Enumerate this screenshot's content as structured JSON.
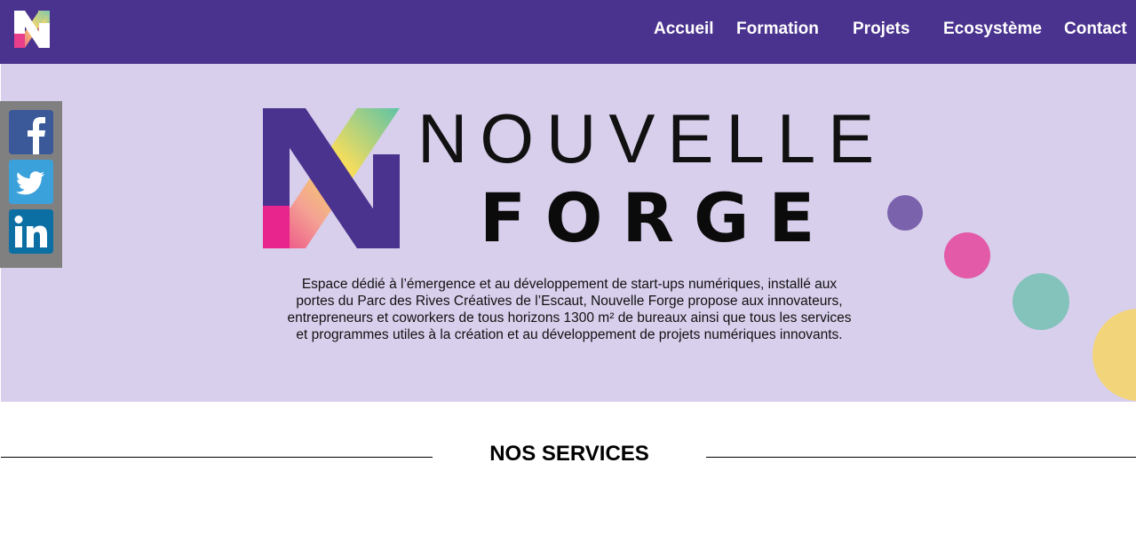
{
  "nav": {
    "items": [
      {
        "label": "Accueil"
      },
      {
        "label": "Formation"
      },
      {
        "label": "Projets"
      },
      {
        "label": "Ecosystème"
      },
      {
        "label": "Contact"
      }
    ]
  },
  "hero": {
    "brand_line1": "NOUVELLE",
    "brand_line2": "FORGE",
    "description": "Espace dédié à l’émergence et au développement de start-ups numériques, installé aux portes du Parc des Rives Créatives de l’Escaut, Nouvelle Forge propose aux innovateurs, entrepreneurs et coworkers de tous horizons 1300 m² de bureaux ainsi que tous les services et programmes utiles à la création et au développement de projets numériques innovants."
  },
  "social": {
    "icons": [
      "facebook-icon",
      "twitter-icon",
      "linkedin-icon"
    ]
  },
  "services": {
    "title": "NOS SERVICES"
  },
  "colors": {
    "header_bg": "#4a338e",
    "hero_bg": "#d8cfec",
    "social_bg": "#808080",
    "dot_purple": "#7a62ad",
    "dot_pink": "#e35ba8",
    "dot_teal": "#83c3bb",
    "dot_yellow": "#f2d47a"
  }
}
